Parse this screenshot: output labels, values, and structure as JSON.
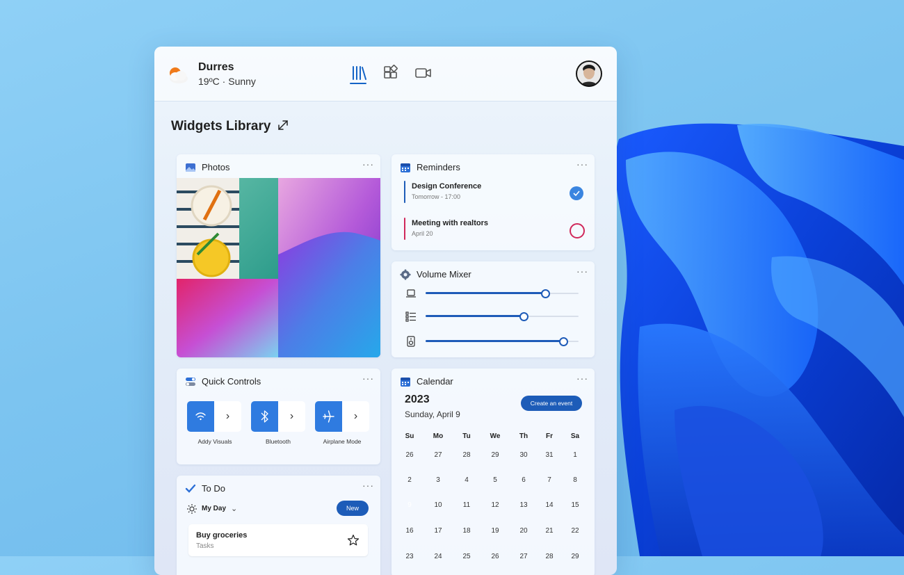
{
  "header": {
    "city": "Durres",
    "condition": "19ºC · Sunny",
    "weather_icon": "partly-sunny-icon",
    "tabs": [
      {
        "icon": "library-icon",
        "active": true
      },
      {
        "icon": "widgets-icon",
        "active": false
      },
      {
        "icon": "video-icon",
        "active": false
      }
    ],
    "avatar": "user-avatar"
  },
  "library": {
    "title": "Widgets Library",
    "expand_icon": "expand-icon"
  },
  "photos": {
    "title": "Photos"
  },
  "reminders": {
    "title": "Reminders",
    "items": [
      {
        "title": "Design Conference",
        "subtitle": "Tomorrow - 17:00",
        "done": true,
        "color": "#1d5cb8"
      },
      {
        "title": "Meeting with realtors",
        "subtitle": "April 20",
        "done": false,
        "color": "#d0275a"
      }
    ]
  },
  "volume": {
    "title": "Volume Mixer",
    "rows": [
      {
        "icon": "laptop-icon",
        "level": 0.78
      },
      {
        "icon": "list-icon",
        "level": 0.64
      },
      {
        "icon": "speaker-icon",
        "level": 0.9
      }
    ]
  },
  "quick_controls": {
    "title": "Quick Controls",
    "items": [
      {
        "label": "Addy Visuals",
        "icon": "wifi-icon"
      },
      {
        "label": "Bluetooth",
        "icon": "bluetooth-icon"
      },
      {
        "label": "Airplane Mode",
        "icon": "airplane-icon"
      }
    ]
  },
  "calendar": {
    "title": "Calendar",
    "year": "2023",
    "date": "Sunday, April 9",
    "create_label": "Create an event",
    "weekdays": [
      "Su",
      "Mo",
      "Tu",
      "We",
      "Th",
      "Fr",
      "Sa"
    ],
    "weeks": [
      [
        "26",
        "27",
        "28",
        "29",
        "30",
        "31",
        "1"
      ],
      [
        "2",
        "3",
        "4",
        "5",
        "6",
        "7",
        "8"
      ],
      [
        "9",
        "10",
        "11",
        "12",
        "13",
        "14",
        "15"
      ],
      [
        "16",
        "17",
        "18",
        "19",
        "20",
        "21",
        "22"
      ],
      [
        "23",
        "24",
        "25",
        "26",
        "27",
        "28",
        "29"
      ]
    ],
    "selected": "9"
  },
  "todo": {
    "title": "To Do",
    "list_name": "My Day",
    "new_label": "New",
    "item": {
      "title": "Buy groceries",
      "subtitle": "Tasks"
    }
  },
  "colors": {
    "accent": "#1d5cb8",
    "alert": "#d0275a"
  }
}
